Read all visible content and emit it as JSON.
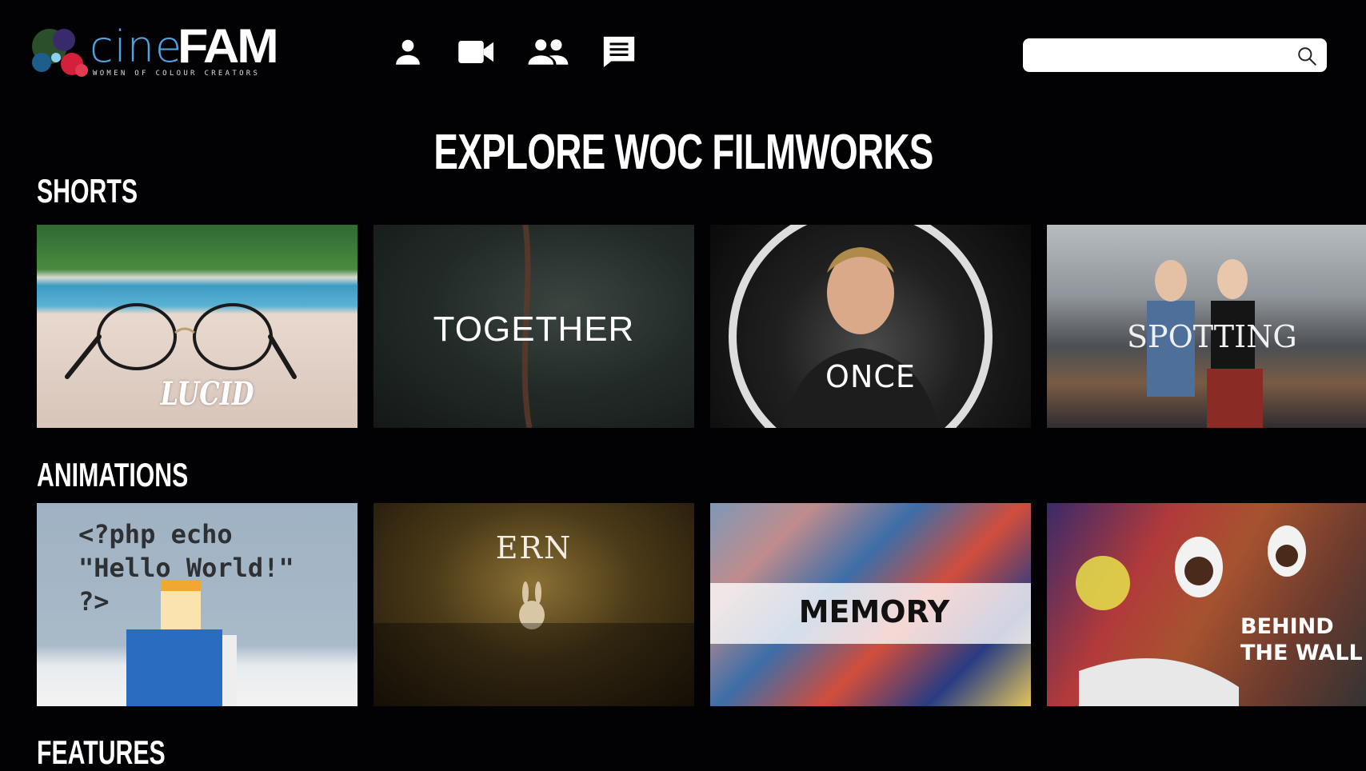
{
  "app": {
    "logo_text_cine": "cine",
    "logo_text_fam": "FAM",
    "logo_tagline": "WOMEN OF COLOUR CREATORS"
  },
  "nav": [
    {
      "name": "profile",
      "icon": "person-icon"
    },
    {
      "name": "videos",
      "icon": "videocam-icon"
    },
    {
      "name": "community",
      "icon": "group-icon"
    },
    {
      "name": "messages",
      "icon": "chat-icon"
    }
  ],
  "search": {
    "placeholder": "",
    "value": "",
    "icon": "search-icon"
  },
  "page_title": "EXPLORE WOC FILMWORKS",
  "sections": {
    "shorts": {
      "title": "SHORTS",
      "items": [
        "LUCID",
        "TOGETHER",
        "ONCE",
        "SPOTTING"
      ]
    },
    "animations": {
      "title": "ANIMATIONS",
      "items": [
        "<?php echo\n\"Hello World!\"\n?>",
        "ERN",
        "MEMORY",
        "BEHIND\nTHE WALL"
      ]
    },
    "features": {
      "title": "FEATURES"
    }
  },
  "colors": {
    "background": "#020205",
    "logo_blue": "#4fa3e0",
    "search_bg": "#ffffff"
  }
}
